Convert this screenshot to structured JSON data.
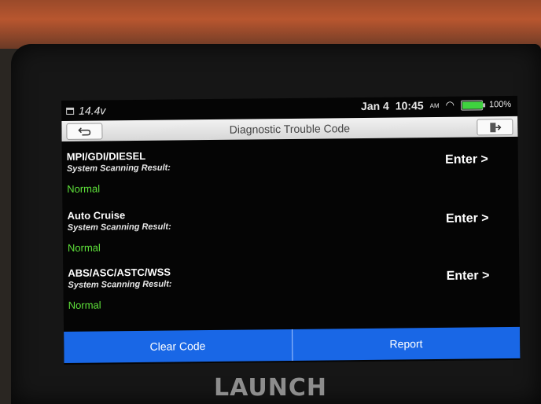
{
  "status": {
    "voltage": "14.4v",
    "date": "Jan 4",
    "time": "10:45",
    "ampm": "AM",
    "battery": "100%"
  },
  "header": {
    "title": "Diagnostic Trouble Code",
    "back_icon": "back-arrow-icon",
    "exit_icon": "exit-icon"
  },
  "systems": [
    {
      "name": "MPI/GDI/DIESEL",
      "label": "System Scanning Result:",
      "result": "Normal",
      "action": "Enter >"
    },
    {
      "name": "Auto Cruise",
      "label": "System Scanning Result:",
      "result": "Normal",
      "action": "Enter >"
    },
    {
      "name": "ABS/ASC/ASTC/WSS",
      "label": "System Scanning Result:",
      "result": "Normal",
      "action": "Enter >"
    }
  ],
  "footer": {
    "clear_label": "Clear Code",
    "report_label": "Report"
  },
  "device": {
    "brand": "LAUNCH"
  },
  "colors": {
    "accent": "#1967e6",
    "normal": "#5ee03a"
  }
}
